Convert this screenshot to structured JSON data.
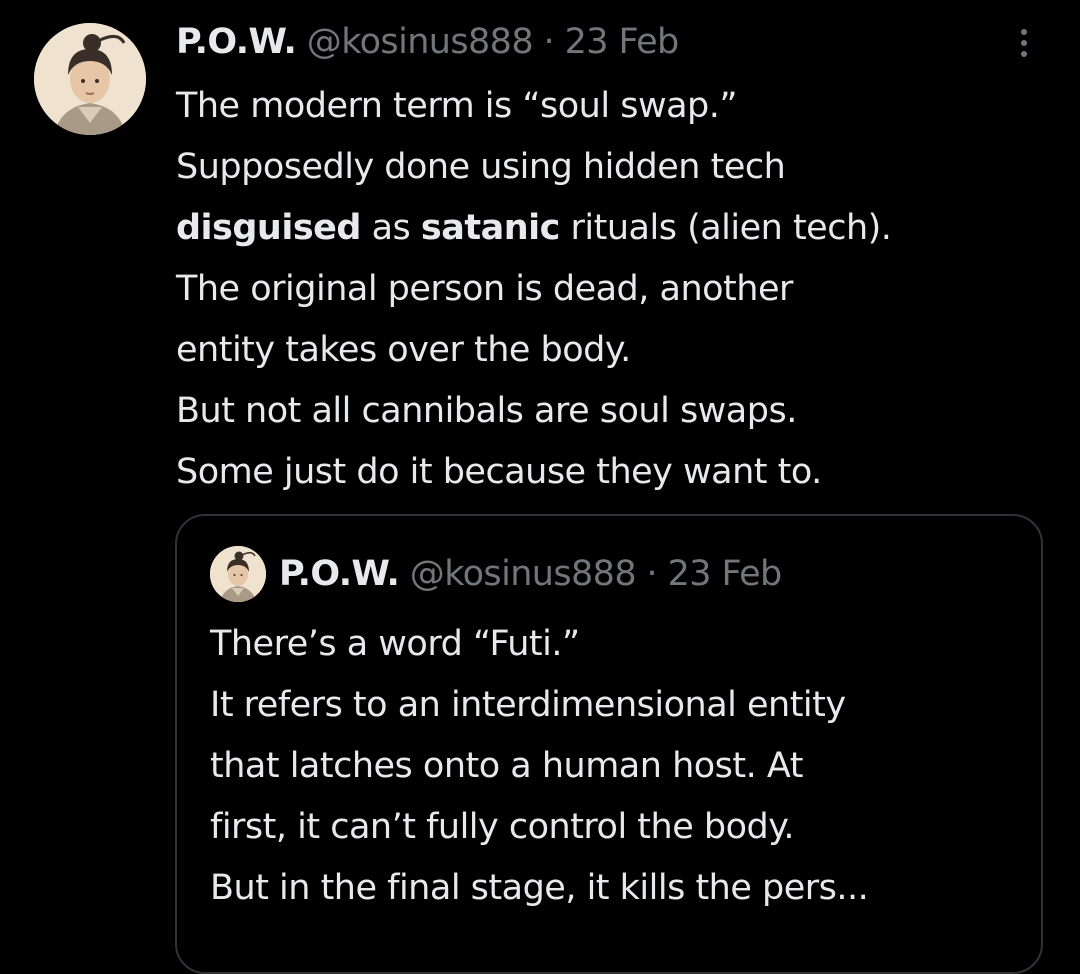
{
  "tweet": {
    "author_name": "P.O.W.",
    "author_handle": "@kosinus888",
    "separator": "·",
    "date": "23 Feb",
    "more_icon": "more-vertical-icon",
    "body_lines": [
      {
        "text": "The modern term is “soul swap.”"
      },
      {
        "text": "Supposedly done using hidden tech"
      },
      {
        "bold1": "disguised",
        "mid": " as ",
        "bold2": "satanic",
        "rest": " rituals (alien tech)."
      },
      {
        "text": "The original person is dead, another"
      },
      {
        "text": "entity takes over the body."
      },
      {
        "text": "But not all cannibals are soul swaps."
      },
      {
        "text": "Some just do it because they want to."
      }
    ]
  },
  "quoted_tweet": {
    "author_name": "P.O.W.",
    "author_handle": "@kosinus888",
    "separator": "·",
    "date": "23 Feb",
    "body_lines": [
      "There’s a word “Futi.”",
      "It refers to an interdimensional entity",
      "that latches onto a human host. At",
      "first, it can’t fully control the body.",
      "But in the final stage, it kills the pers..."
    ]
  },
  "colors": {
    "background": "#000000",
    "primary_text": "#e7e9ea",
    "secondary_text": "#71767b",
    "border": "#2f3336"
  }
}
